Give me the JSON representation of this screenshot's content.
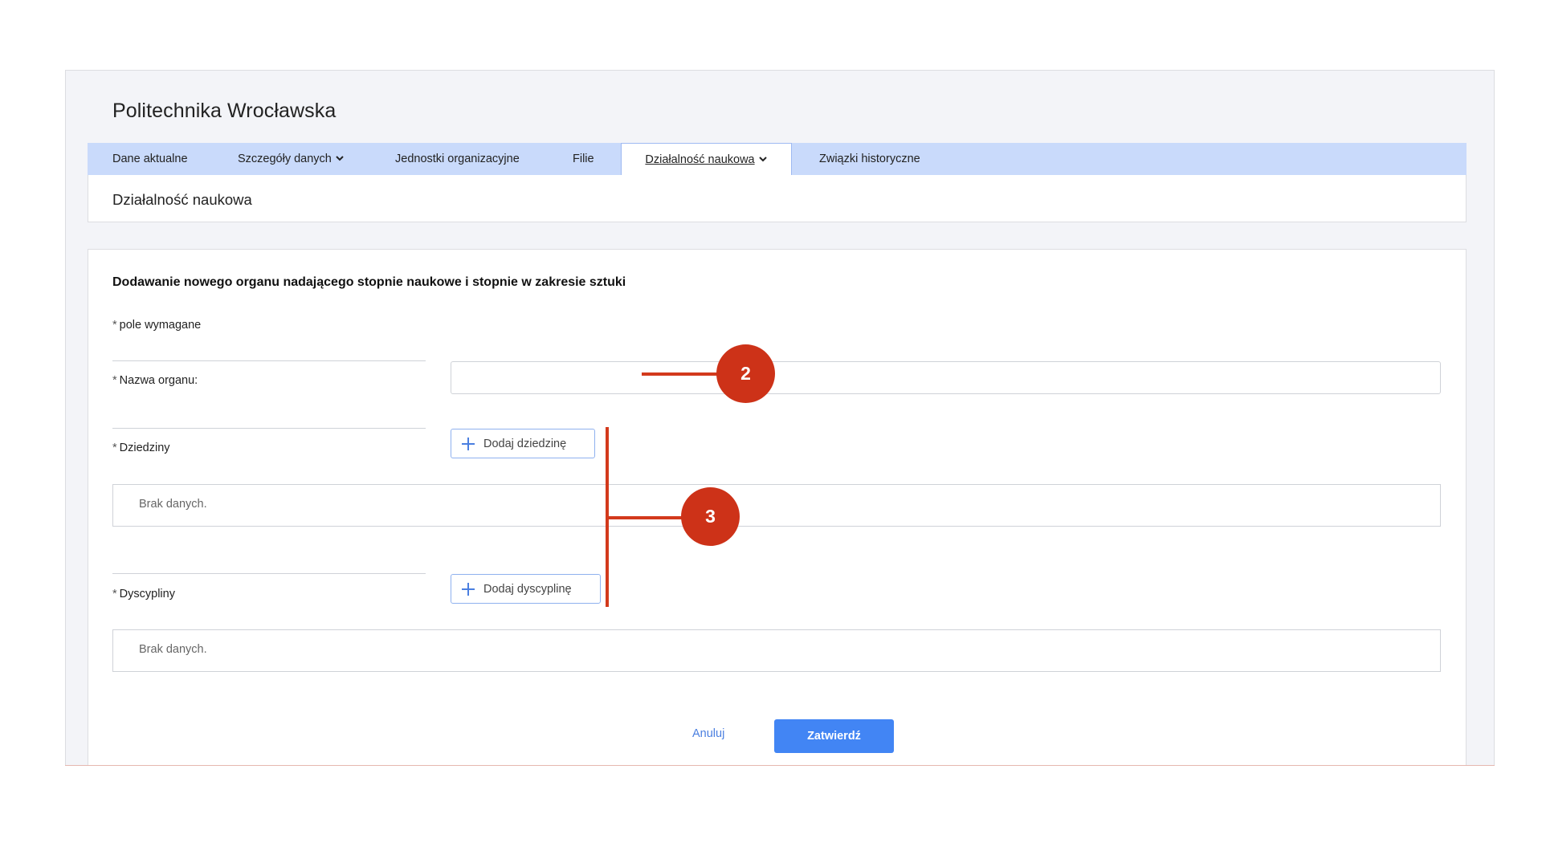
{
  "header": {
    "organization_title": "Politechnika Wrocławska"
  },
  "tabs": [
    {
      "label": "Dane aktualne",
      "has_dropdown": false,
      "active": false
    },
    {
      "label": "Szczegóły danych",
      "has_dropdown": true,
      "active": false
    },
    {
      "label": "Jednostki organizacyjne",
      "has_dropdown": false,
      "active": false
    },
    {
      "label": "Filie",
      "has_dropdown": false,
      "active": false
    },
    {
      "label": "Działalność naukowa",
      "has_dropdown": true,
      "active": true
    },
    {
      "label": "Związki historyczne",
      "has_dropdown": false,
      "active": false
    }
  ],
  "section": {
    "title": "Działalność naukowa"
  },
  "form": {
    "heading": "Dodawanie nowego organu nadającego stopnie naukowe i stopnie w zakresie sztuki",
    "required_marker": "*",
    "required_note": "pole wymagane",
    "name_field": {
      "label": "Nazwa organu:",
      "value": "",
      "placeholder": ""
    },
    "domains": {
      "label": "Dziedziny",
      "add_button": "Dodaj dziedzinę",
      "empty_text": "Brak danych."
    },
    "disciplines": {
      "label": "Dyscypliny",
      "add_button": "Dodaj dyscyplinę",
      "empty_text": "Brak danych."
    },
    "cancel_label": "Anuluj",
    "confirm_label": "Zatwierdź"
  },
  "annotations": [
    {
      "number": "2"
    },
    {
      "number": "3"
    }
  ],
  "colors": {
    "tab_bar": "#c9dafb",
    "primary_button": "#4285f4",
    "annotation": "#cd3218"
  },
  "icons": {
    "dropdown": "chevron-down-icon",
    "add": "plus-icon"
  }
}
